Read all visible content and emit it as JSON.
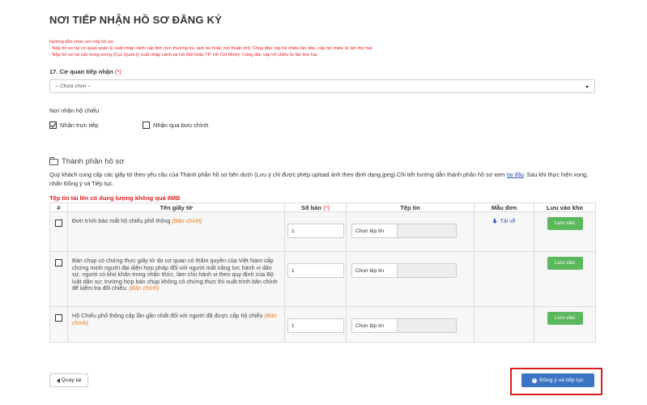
{
  "page": {
    "title": "NƠI TIẾP NHẬN HỒ SƠ ĐĂNG KÝ",
    "guide": {
      "heading": "Hướng dẫn chọn nơi nộp hồ sơ:",
      "line1": "- Nộp hồ sơ tại cơ quan quản lý xuất nhập cảnh cấp tỉnh (nơi thường trú, tạm trú hoặc nơi thuận lợi): Công dân cấp hộ chiếu lần đầu, cấp hộ chiếu từ lần thứ hai;",
      "line2": "- Nộp hồ sơ tại cấp trung ương (Cục Quản lý xuất nhập cảnh tại Hà Nội hoặc TP. Hồ Chí Minh): Công dân cấp hộ chiếu từ lần thứ hai."
    }
  },
  "agency": {
    "label": "17. Cơ quan tiếp nhận",
    "required_mark": "(*)",
    "selected": "-- Chưa chọn --"
  },
  "receive": {
    "label": "Nơi nhận hộ chiếu",
    "options": [
      {
        "label": "Nhận trực tiếp",
        "checked": true
      },
      {
        "label": "Nhận qua bưu chính",
        "checked": false
      }
    ]
  },
  "docs": {
    "section_title": "Thành phần hồ sơ",
    "desc_part1": "Quý khách cung cấp các giấy tờ theo yêu cầu của Thành phần hồ sơ bên dưới (Lưu ý chỉ được phép upload ảnh theo định dạng jpeg).Chi tiết hướng dẫn thành phần hồ sơ xem",
    "desc_link": "tại đây",
    "desc_part2": ". Sau khi thực hiện xong, nhấn Đồng ý và Tiếp tục.",
    "size_limit": "Tệp tin tải lên có dung lượng không quá 6MB",
    "columns": {
      "no": "#",
      "name": "Tên giấy tờ",
      "qty": "Số bản",
      "qty_req": "(*)",
      "file": "Tệp tin",
      "template": "Mẫu đơn",
      "save": "Lưu vào kho"
    },
    "original_tag": "(Bản chính)",
    "choose_file": "Chọn tệp tin",
    "download_label": "Tải về",
    "save_label": "Lưu vào",
    "rows": [
      {
        "name": "Đơn trình báo mất hộ chiếu phổ thông",
        "qty": "1"
      },
      {
        "name": "Bản chụp có chứng thực giấy tờ do cơ quan có thẩm quyền của Việt Nam cấp chứng minh người đại diện hợp pháp đối với người mất năng lực hành vi dân sự, người có khó khăn trong nhận thức, làm chủ hành vi theo quy định của Bộ luật dân sự; trường hợp bản chụp không có chứng thực thì xuất trình bản chính để kiểm tra đối chiếu.",
        "qty": "1"
      },
      {
        "name": "Hộ Chiếu phổ thông cấp lần gần nhất đối với người đã được cấp hộ chiếu",
        "qty": "1"
      }
    ]
  },
  "footer": {
    "back_label": "Quay lại",
    "next_label": "Đồng ý và tiếp tục"
  }
}
